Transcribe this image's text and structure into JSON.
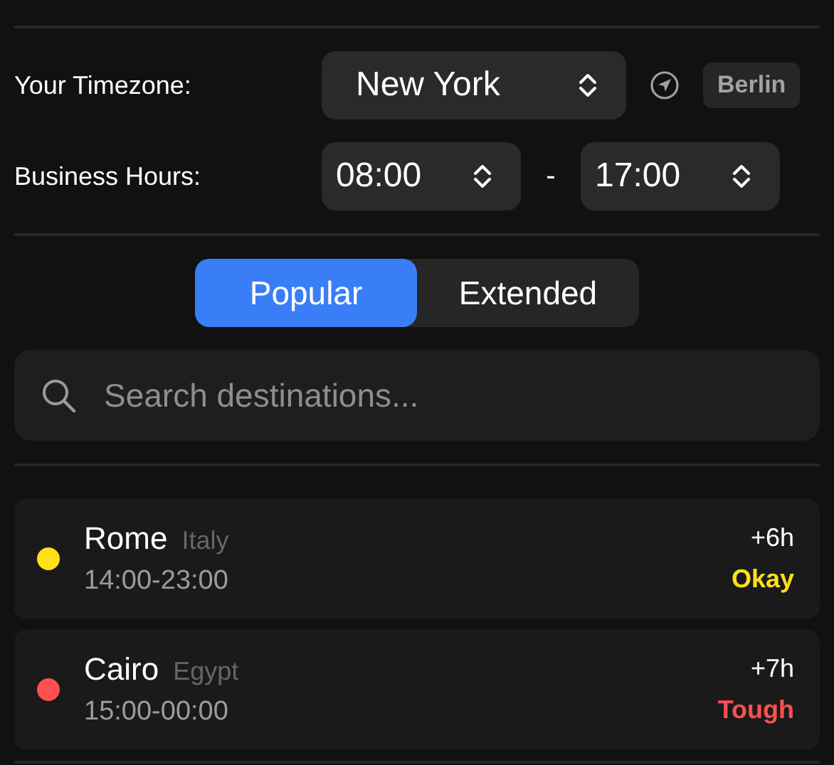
{
  "timezone": {
    "label": "Your Timezone:",
    "value": "New York",
    "home_city": "Berlin"
  },
  "business_hours": {
    "label": "Business Hours:",
    "start": "08:00",
    "separator": "-",
    "end": "17:00"
  },
  "tabs": [
    {
      "label": "Popular",
      "selected": true
    },
    {
      "label": "Extended",
      "selected": false
    }
  ],
  "search": {
    "placeholder": "Search destinations..."
  },
  "destinations": [
    {
      "city": "Rome",
      "country": "Italy",
      "hours": "14:00-23:00",
      "offset": "+6h",
      "rating": "Okay",
      "color": "#ffe019"
    },
    {
      "city": "Cairo",
      "country": "Egypt",
      "hours": "15:00-00:00",
      "offset": "+7h",
      "rating": "Tough",
      "color": "#ff4f4f"
    }
  ]
}
